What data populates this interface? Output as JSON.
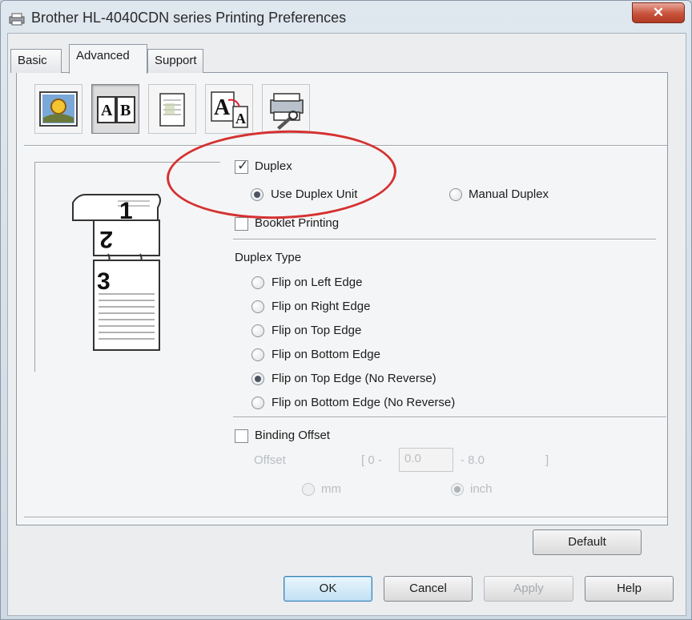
{
  "window": {
    "title": "Brother HL-4040CDN series Printing Preferences",
    "close_label": "✕"
  },
  "tabs": [
    {
      "label": "Basic",
      "selected": false
    },
    {
      "label": "Advanced",
      "selected": true
    },
    {
      "label": "Support",
      "selected": false
    }
  ],
  "toolbar_icons": [
    "color-settings-icon",
    "duplex-icon",
    "watermark-icon",
    "text-scaling-icon",
    "device-options-icon"
  ],
  "preview": {
    "page_numbers": [
      "1",
      "2",
      "3"
    ]
  },
  "duplex": {
    "label": "Duplex",
    "checked": true,
    "use_unit_label": "Use Duplex Unit",
    "manual_label": "Manual Duplex",
    "selected": "use_unit"
  },
  "booklet": {
    "label": "Booklet Printing",
    "checked": false
  },
  "duplex_type": {
    "heading": "Duplex Type",
    "options": [
      "Flip on Left Edge",
      "Flip on Right Edge",
      "Flip on Top Edge",
      "Flip on Bottom Edge",
      "Flip on Top Edge (No Reverse)",
      "Flip on Bottom Edge (No Reverse)"
    ],
    "selected_index": 4
  },
  "binding": {
    "label": "Binding Offset",
    "checked": false,
    "offset_label": "Offset",
    "range_open": "[ 0 -",
    "value": "0.0",
    "range_close": "- 8.0",
    "bracket": "]",
    "unit_mm": "mm",
    "unit_inch": "inch",
    "selected_unit": "inch"
  },
  "buttons": {
    "default": "Default",
    "ok": "OK",
    "cancel": "Cancel",
    "apply": "Apply",
    "help": "Help"
  },
  "colors": {
    "highlight": "#d53131",
    "ok_border": "#3c7fb1"
  }
}
